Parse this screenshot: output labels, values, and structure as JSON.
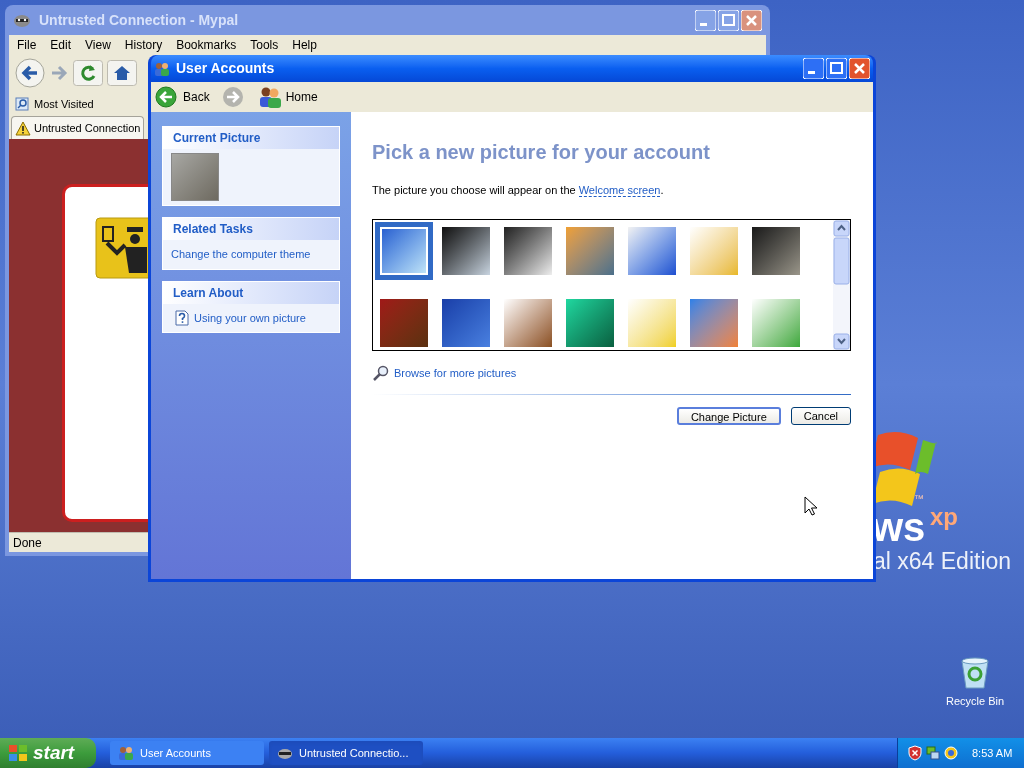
{
  "desktop": {
    "logo_word": "ws",
    "logo_xp": "xp",
    "logo_tm": "™",
    "edition": "al x64 Edition",
    "icons": [
      {
        "label": "Recycle Bin"
      }
    ]
  },
  "browser_window": {
    "title": "Untrusted Connection - Mypal",
    "active": false,
    "menu": [
      "File",
      "Edit",
      "View",
      "History",
      "Bookmarks",
      "Tools",
      "Help"
    ],
    "bookmarks": [
      "Most Visited"
    ],
    "tabs": [
      {
        "label": "Untrusted Connection",
        "selected": true
      }
    ],
    "status": "Done"
  },
  "dialog": {
    "title": "User Accounts",
    "active": true,
    "nav": {
      "back": "Back",
      "home": "Home"
    },
    "sidebar": [
      {
        "kind": "picture",
        "title": "Current Picture"
      },
      {
        "kind": "links",
        "title": "Related Tasks",
        "items": [
          "Change the computer theme"
        ]
      },
      {
        "kind": "help",
        "title": "Learn About",
        "items": [
          "Using your own picture"
        ]
      }
    ],
    "heading": "Pick a new picture for your account",
    "description": "The picture you choose will appear on the ",
    "description_link": "Welcome screen",
    "description_end": ".",
    "pictures": [
      {
        "selected": true
      },
      {
        "selected": false
      },
      {
        "selected": false
      },
      {
        "selected": false
      },
      {
        "selected": false
      },
      {
        "selected": false
      },
      {
        "selected": false
      },
      {
        "selected": false
      },
      {
        "selected": false
      },
      {
        "selected": false
      },
      {
        "selected": false
      },
      {
        "selected": false
      },
      {
        "selected": false
      },
      {
        "selected": false
      }
    ],
    "browse_link": "Browse for more pictures",
    "buttons": [
      {
        "label": "Change Picture",
        "default": true
      },
      {
        "label": "Cancel",
        "default": false
      }
    ]
  },
  "taskbar": {
    "start": "start",
    "tasks": [
      {
        "label": "User Accounts",
        "selected": false
      },
      {
        "label": "Untrusted Connectio...",
        "selected": true
      }
    ],
    "clock": "8:53 AM"
  }
}
